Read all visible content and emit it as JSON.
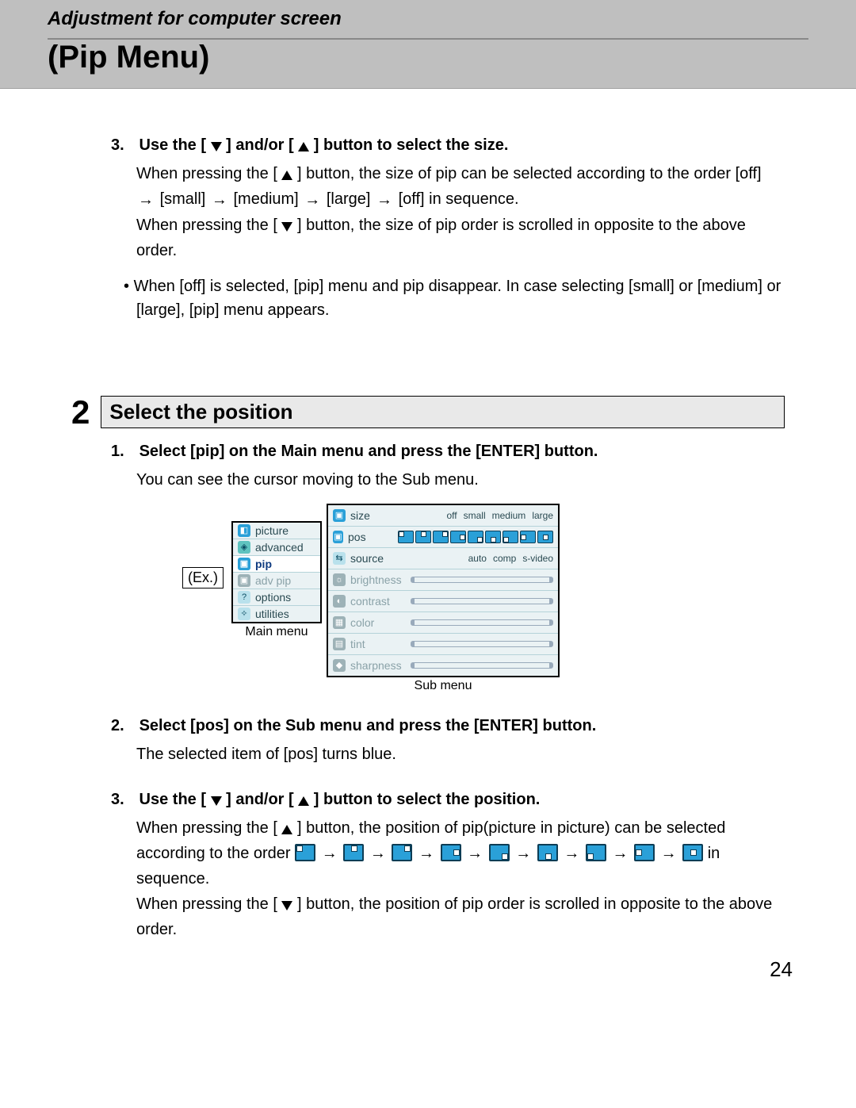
{
  "header": {
    "section_title": "Adjustment for computer screen",
    "page_title": "(Pip Menu)"
  },
  "step3a": {
    "lead_num": "3.",
    "lead_text": "Use the [ ▽ ] and/or [ △ ] button to select the size.",
    "body1_a": "When pressing the [",
    "body1_b": "] button, the size of pip can be selected according to the order [off]",
    "seq": {
      "a": "[small]",
      "b": "[medium]",
      "c": "[large]",
      "d": "[off] in sequence."
    },
    "body3_a": "When pressing the [",
    "body3_b": "] button, the size of pip order is scrolled in opposite to the above order.",
    "bullet": "When [off] is selected, [pip] menu and pip disappear. In case selecting [small] or [medium] or [large], [pip] menu appears."
  },
  "big_step": {
    "num": "2",
    "title": "Select the position"
  },
  "step1b": {
    "lead_num": "1.",
    "lead_text": "Select [pip] on the Main menu and press the [ENTER] button.",
    "body": "You can see the cursor moving to the Sub menu."
  },
  "example": {
    "ex_label": "(Ex.)",
    "main_caption": "Main menu",
    "sub_caption": "Sub menu",
    "mainmenu": {
      "picture": "picture",
      "advanced": "advanced",
      "pip": "pip",
      "adv_pip": "adv pip",
      "options": "options",
      "utilities": "utilities"
    },
    "submenu": {
      "size": {
        "label": "size",
        "opts": [
          "off",
          "small",
          "medium",
          "large"
        ]
      },
      "pos": {
        "label": "pos"
      },
      "source": {
        "label": "source",
        "opts": [
          "auto",
          "comp",
          "s-video"
        ]
      },
      "brightness": "brightness",
      "contrast": "contrast",
      "color": "color",
      "tint": "tint",
      "sharpness": "sharpness"
    }
  },
  "step2b": {
    "lead_num": "2.",
    "lead_text": "Select [pos] on the Sub menu and press the [ENTER] button.",
    "body": "The selected item of [pos] turns blue."
  },
  "step3b": {
    "lead_num": "3.",
    "lead_text": "Use the [ ▽ ] and/or [ △ ] button to select the position.",
    "body1_a": "When pressing the [",
    "body1_b": "] button, the position of pip(picture in picture) can be selected according to the order",
    "tail": "in sequence.",
    "body2_a": "When pressing the [",
    "body2_b": "] button, the position of pip order is scrolled in opposite to the above order."
  },
  "page_number": "24"
}
